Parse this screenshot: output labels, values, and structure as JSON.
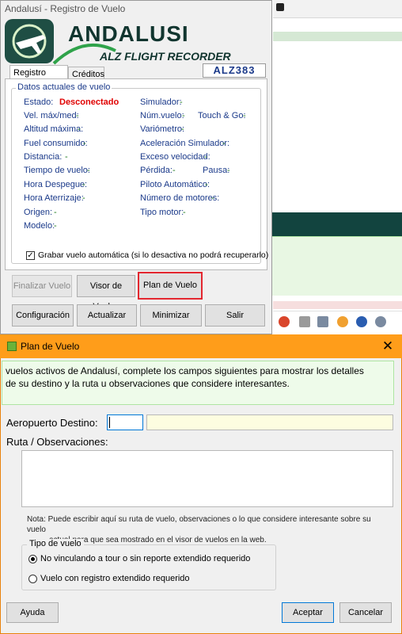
{
  "main_window": {
    "title": "Andalusí - Registro de Vuelo",
    "logo": {
      "brand": "ANDALUSI",
      "subtitle": "ALZ FLIGHT RECORDER"
    },
    "callsign": "ALZ383",
    "tabs": [
      {
        "label": "Registro Vuelo",
        "active": true
      },
      {
        "label": "Créditos",
        "active": false
      }
    ],
    "group_title": "Datos actuales de vuelo",
    "fields": {
      "estado": {
        "label": "Estado:",
        "value": "Desconectado"
      },
      "vel": {
        "label": "Vel. máx/med:",
        "value": "-"
      },
      "altitud": {
        "label": "Altitud máxima:",
        "value": "-"
      },
      "fuel": {
        "label": "Fuel consumido:",
        "value": "-"
      },
      "distancia": {
        "label": "Distancia:",
        "value": "-"
      },
      "tiempo": {
        "label": "Tiempo de vuelo:",
        "value": "-"
      },
      "despegue": {
        "label": "Hora Despegue:",
        "value": "-"
      },
      "aterrizaje": {
        "label": "Hora Aterrizaje:",
        "value": "-"
      },
      "origen": {
        "label": "Origen:",
        "value": "-"
      },
      "modelo": {
        "label": "Modelo:",
        "value": "-"
      },
      "simulador": {
        "label": "Simulador:",
        "value": "-"
      },
      "num_vuelo": {
        "label": "Núm.vuelo:",
        "value": "-"
      },
      "touch_go": {
        "label": "Touch & Go:",
        "value": "-"
      },
      "variometro": {
        "label": "Variómetro:",
        "value": "-"
      },
      "aceleracion": {
        "label": "Aceleración Simulador:",
        "value": "-"
      },
      "exceso": {
        "label": "Exceso velocidad:",
        "value": "-"
      },
      "perdida": {
        "label": "Pérdida:",
        "value": "-"
      },
      "pausa": {
        "label": "Pausa:",
        "value": "-"
      },
      "piloto": {
        "label": "Piloto Automático:",
        "value": "-"
      },
      "motores": {
        "label": "Número de motores:",
        "value": "-"
      },
      "tipo_motor": {
        "label": "Tipo motor:",
        "value": "-"
      }
    },
    "auto_record": {
      "label": "Grabar vuelo automática (si lo desactiva no podrá recuperarlo)",
      "checked": true
    },
    "buttons": {
      "finalizar": "Finalizar Vuelo",
      "visor": "Visor de Vuelos",
      "plan": "Plan de Vuelo",
      "configuracion": "Configuración",
      "actualizar": "Actualizar",
      "minimizar": "Minimizar",
      "salir": "Salir"
    }
  },
  "dialog": {
    "title": "Plan de Vuelo",
    "info_line1": "vuelos activos de Andalusí, complete los campos siguientes para mostrar los detalles",
    "info_line2": "de su destino y la ruta u observaciones que considere interesantes.",
    "dest_label": "Aeropuerto Destino:",
    "dest_code": "",
    "dest_name": "",
    "route_label": "Ruta / Observaciones:",
    "route_value": "",
    "note_line1": "Nota: Puede escribir aquí su ruta de vuelo, observaciones o lo que considere interesante sobre su vuelo",
    "note_line2": "actual para que sea mostrado en el visor de vuelos en la web.",
    "flight_type_title": "Tipo de vuelo",
    "options": [
      {
        "label": "No vinculando a tour o sin reporte extendido requerido",
        "selected": true
      },
      {
        "label": "Vuelo con registro extendido requerido",
        "selected": false
      }
    ],
    "buttons": {
      "help": "Ayuda",
      "accept": "Aceptar",
      "cancel": "Cancelar"
    }
  },
  "colors": {
    "accent_orange": "#ff9d1a",
    "status_red": "#e00000",
    "value_green": "#1b7a1b",
    "label_blue": "#1b3a8a"
  }
}
